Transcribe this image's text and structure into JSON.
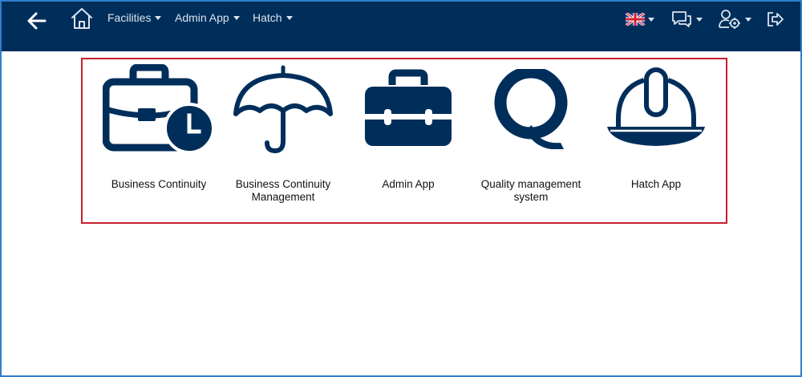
{
  "header": {
    "menus": [
      {
        "label": "Facilities"
      },
      {
        "label": "Admin App"
      },
      {
        "label": "Hatch"
      }
    ]
  },
  "icons": {
    "back": "arrow-left-icon",
    "home": "home-icon",
    "language": "uk-flag-icon",
    "chat": "chat-bubbles-icon",
    "user_settings": "user-gear-icon",
    "logout": "logout-icon"
  },
  "apps": [
    {
      "label": "Business Continuity",
      "icon": "briefcase-clock-icon"
    },
    {
      "label": "Business Continuity Management",
      "icon": "umbrella-icon"
    },
    {
      "label": "Admin App",
      "icon": "toolbox-icon"
    },
    {
      "label": "Quality management system",
      "icon": "letter-q-icon"
    },
    {
      "label": "Hatch App",
      "icon": "hard-hat-icon"
    }
  ],
  "colors": {
    "header_bg": "#002e5b",
    "icon_color": "#002e5b",
    "highlight_border": "#c81e2b",
    "frame_border": "#2f7fc9"
  }
}
